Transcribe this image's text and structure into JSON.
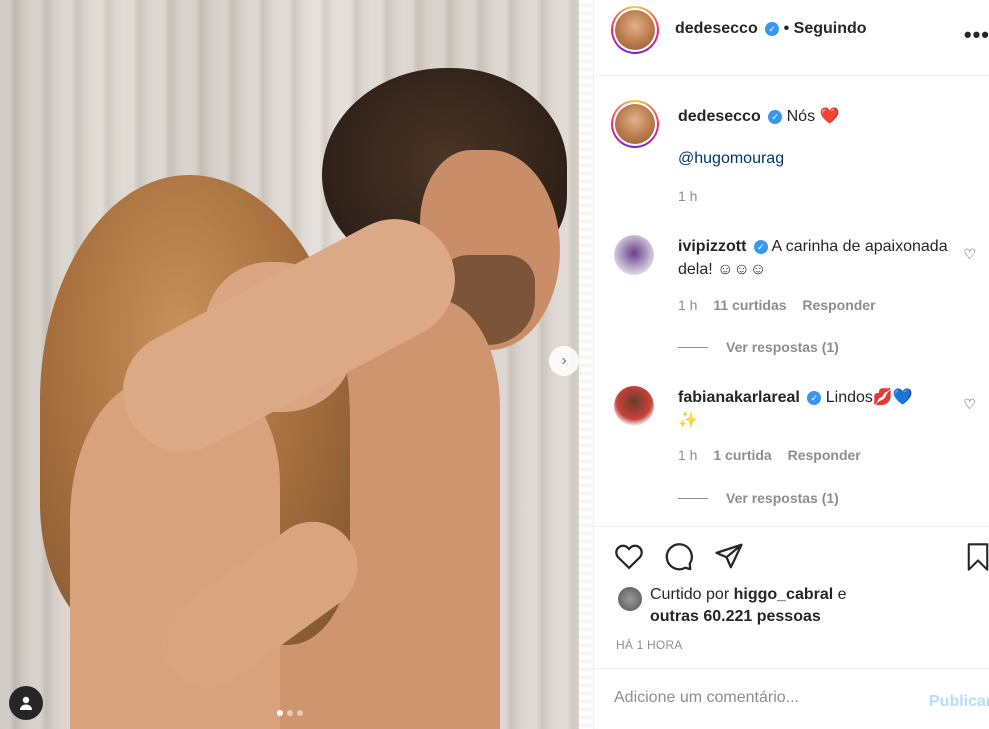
{
  "post": {
    "author": "dedesecco",
    "follow_status": "• Seguindo",
    "more": "•••",
    "caption_text": "Nós",
    "caption_emoji": "❤️",
    "caption_mention": "@hugomourag",
    "caption_time": "1 h",
    "carousel": {
      "next_icon": "›",
      "slides": 3,
      "active_slide": 1
    }
  },
  "comments": [
    {
      "username": "ivipizzott",
      "text": "A carinha de apaixonada dela! ☺☺☺",
      "time": "1 h",
      "likes": "11 curtidas",
      "reply": "Responder",
      "view_replies": "Ver respostas (1)"
    },
    {
      "username": "fabianakarlareal",
      "text": "Lindos💋💙",
      "text2": "✨",
      "time": "1 h",
      "likes": "1 curtida",
      "reply": "Responder",
      "view_replies": "Ver respostas (1)"
    }
  ],
  "likes_summary": {
    "prefix": "Curtido por",
    "user": "higgo_cabral",
    "connector": "e",
    "others": "outras 60.221 pessoas"
  },
  "timestamp": "HÁ 1 HORA",
  "add_comment": {
    "placeholder": "Adicione um comentário...",
    "publish": "Publicar"
  }
}
